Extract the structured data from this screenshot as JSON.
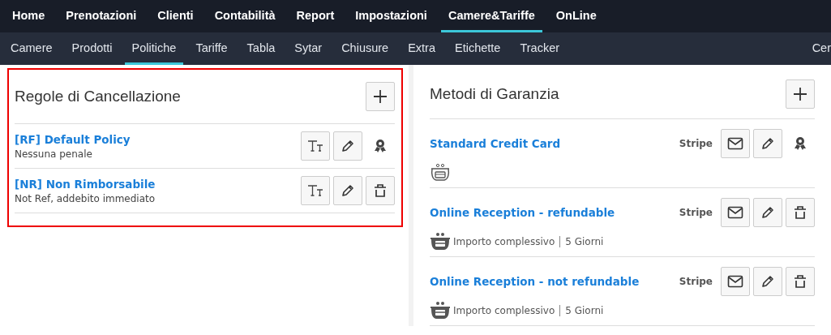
{
  "main_nav": [
    {
      "label": "Home",
      "selected": false
    },
    {
      "label": "Prenotazioni",
      "selected": false
    },
    {
      "label": "Clienti",
      "selected": false
    },
    {
      "label": "Contabilità",
      "selected": false
    },
    {
      "label": "Report",
      "selected": false
    },
    {
      "label": "Impostazioni",
      "selected": false
    },
    {
      "label": "Camere&Tariffe",
      "selected": true
    },
    {
      "label": "OnLine",
      "selected": false
    }
  ],
  "sub_nav": [
    {
      "label": "Camere",
      "selected": false
    },
    {
      "label": "Prodotti",
      "selected": false
    },
    {
      "label": "Politiche",
      "selected": true
    },
    {
      "label": "Tariffe",
      "selected": false
    },
    {
      "label": "Tabla",
      "selected": false
    },
    {
      "label": "Sytar",
      "selected": false
    },
    {
      "label": "Chiusure",
      "selected": false
    },
    {
      "label": "Extra",
      "selected": false
    },
    {
      "label": "Etichette",
      "selected": false
    },
    {
      "label": "Tracker",
      "selected": false
    }
  ],
  "sub_nav_right": "Cer",
  "cancellation": {
    "title": "Regole di Cancellazione",
    "highlighted": true,
    "rules": [
      {
        "name": "[RF] Default Policy",
        "description": "Nessuna penale",
        "default": true
      },
      {
        "name": "[NR] Non Rimborsabile",
        "description": "Not Ref, addebito immediato",
        "default": false
      }
    ]
  },
  "guarantee": {
    "title": "Metodi di Garanzia",
    "methods": [
      {
        "name": "Standard Credit Card",
        "provider": "Stripe",
        "default": true,
        "wallet_filled": false
      },
      {
        "name": "Online Reception - refundable",
        "provider": "Stripe",
        "default": false,
        "wallet_filled": true,
        "amount": "Importo complessivo",
        "days": "5 Giorni"
      },
      {
        "name": "Online Reception - not refundable",
        "provider": "Stripe",
        "default": false,
        "wallet_filled": true,
        "amount": "Importo complessivo",
        "days": "5 Giorni"
      }
    ]
  }
}
